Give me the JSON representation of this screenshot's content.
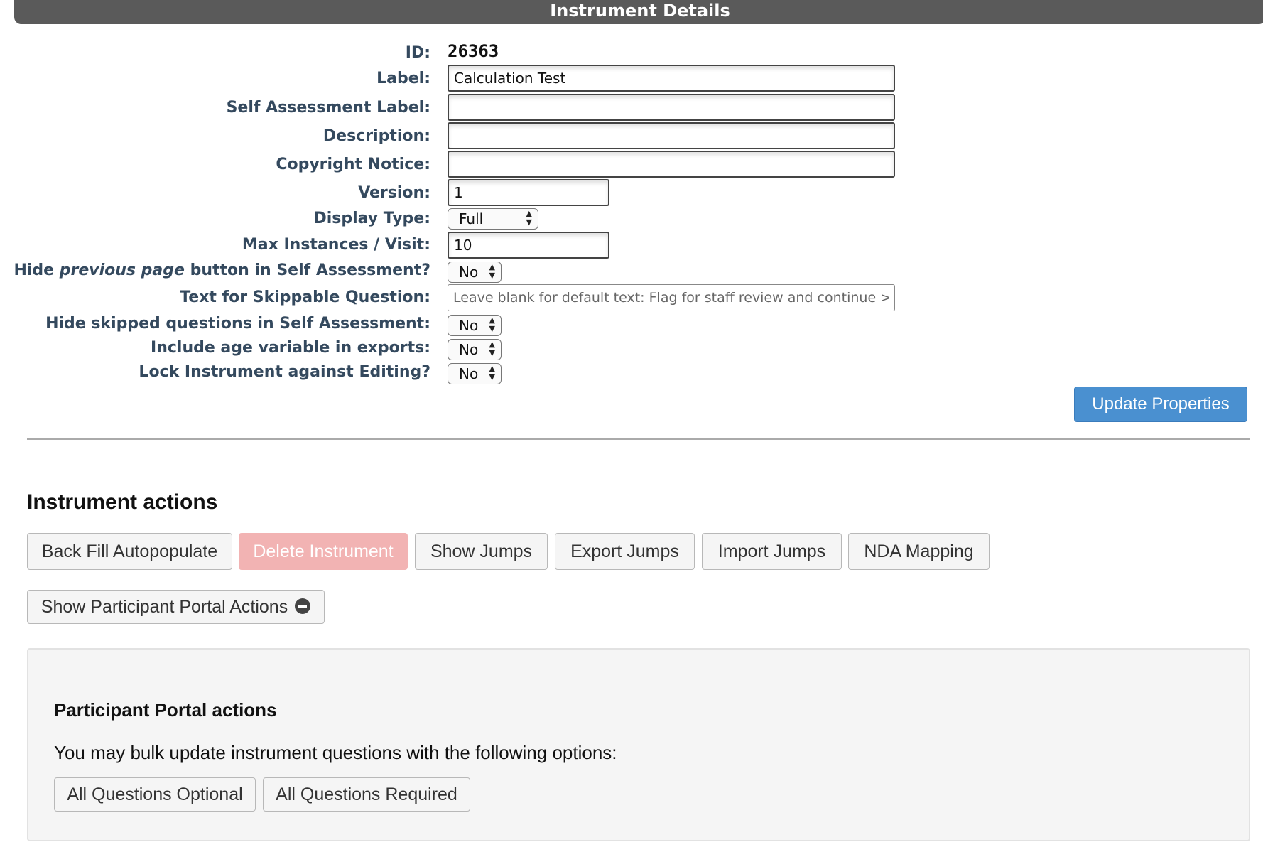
{
  "header": {
    "title": "Instrument Details"
  },
  "form": {
    "id": {
      "label": "ID:",
      "value": "26363"
    },
    "label": {
      "label": "Label:",
      "value": "Calculation Test"
    },
    "self_assessment_label": {
      "label": "Self Assessment Label:",
      "value": ""
    },
    "description": {
      "label": "Description:",
      "value": ""
    },
    "copyright_notice": {
      "label": "Copyright Notice:",
      "value": ""
    },
    "version": {
      "label": "Version:",
      "value": "1"
    },
    "display_type": {
      "label": "Display Type:",
      "value": "Full"
    },
    "max_instances": {
      "label": "Max Instances / Visit:",
      "value": "10"
    },
    "hide_previous": {
      "label_prefix": "Hide ",
      "label_emphasis": "previous page",
      "label_suffix": " button in Self Assessment?",
      "value": "No"
    },
    "skippable_text": {
      "label": "Text for Skippable Question:",
      "value": "",
      "placeholder": "Leave blank for default text: Flag for staff review and continue >"
    },
    "hide_skipped": {
      "label": "Hide skipped questions in Self Assessment:",
      "value": "No"
    },
    "include_age": {
      "label": "Include age variable in exports:",
      "value": "No"
    },
    "lock_instrument": {
      "label": "Lock Instrument against Editing?",
      "value": "No"
    }
  },
  "update_button": "Update Properties",
  "instrument_actions": {
    "heading": "Instrument actions",
    "buttons": {
      "back_fill": "Back Fill Autopopulate",
      "delete": "Delete Instrument",
      "show_jumps": "Show Jumps",
      "export_jumps": "Export Jumps",
      "import_jumps": "Import Jumps",
      "nda_mapping": "NDA Mapping"
    },
    "portal_toggle": "Show Participant Portal Actions"
  },
  "participant_portal": {
    "heading": "Participant Portal actions",
    "description": "You may bulk update instrument questions with the following options:",
    "optional_button": "All Questions Optional",
    "required_button": "All Questions Required"
  }
}
